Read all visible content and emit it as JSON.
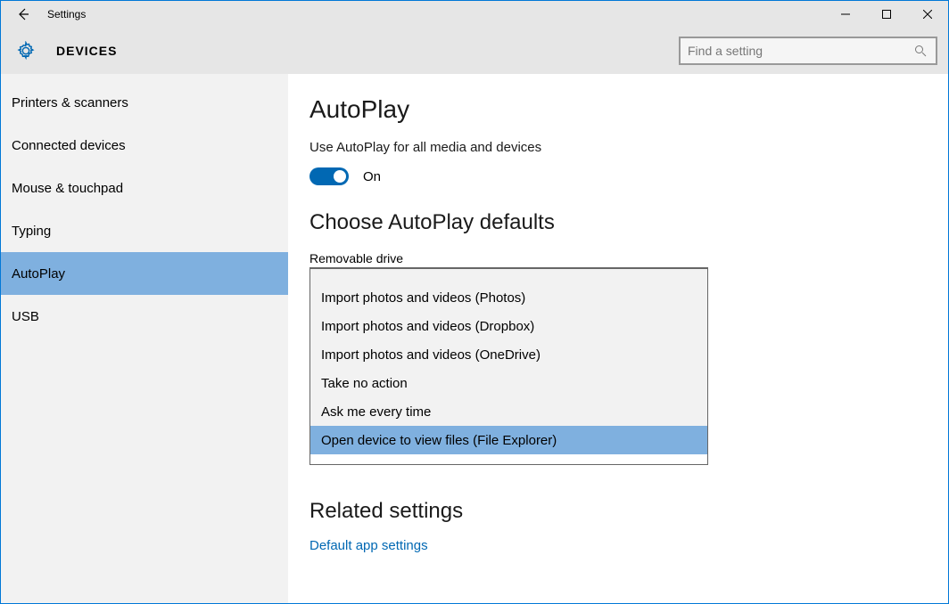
{
  "window": {
    "title": "Settings"
  },
  "header": {
    "section": "DEVICES",
    "search_placeholder": "Find a setting"
  },
  "sidebar": {
    "items": [
      {
        "label": "Printers & scanners"
      },
      {
        "label": "Connected devices"
      },
      {
        "label": "Mouse & touchpad"
      },
      {
        "label": "Typing"
      },
      {
        "label": "AutoPlay"
      },
      {
        "label": "USB"
      }
    ],
    "selected_index": 4
  },
  "main": {
    "heading": "AutoPlay",
    "toggle_label": "Use AutoPlay for all media and devices",
    "toggle_state": "On",
    "defaults_heading": "Choose AutoPlay defaults",
    "removable_label": "Removable drive",
    "options": [
      "Import photos and videos (Photos)",
      "Import photos and videos (Dropbox)",
      "Import photos and videos (OneDrive)",
      "Take no action",
      "Ask me every time",
      "Open device to view files (File Explorer)"
    ],
    "selected_option_index": 5,
    "related_heading": "Related settings",
    "related_link": "Default app settings"
  }
}
